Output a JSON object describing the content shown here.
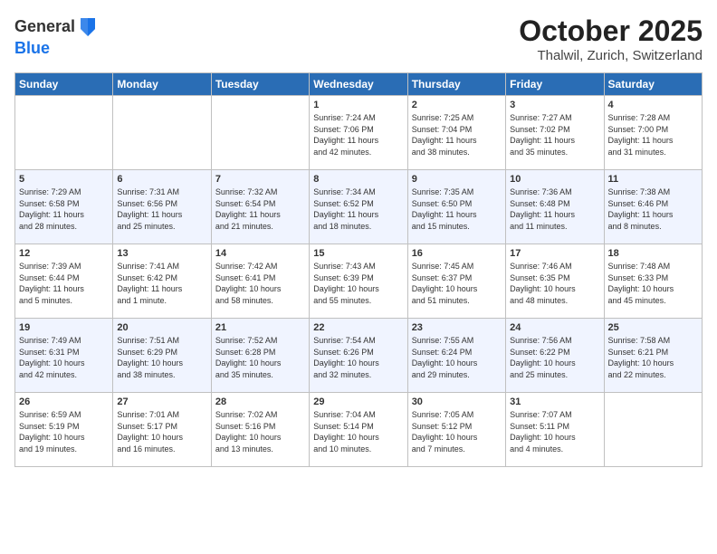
{
  "header": {
    "logo_line1": "General",
    "logo_line2": "Blue",
    "month": "October 2025",
    "location": "Thalwil, Zurich, Switzerland"
  },
  "days_of_week": [
    "Sunday",
    "Monday",
    "Tuesday",
    "Wednesday",
    "Thursday",
    "Friday",
    "Saturday"
  ],
  "weeks": [
    [
      {
        "day": "",
        "info": ""
      },
      {
        "day": "",
        "info": ""
      },
      {
        "day": "",
        "info": ""
      },
      {
        "day": "1",
        "info": "Sunrise: 7:24 AM\nSunset: 7:06 PM\nDaylight: 11 hours\nand 42 minutes."
      },
      {
        "day": "2",
        "info": "Sunrise: 7:25 AM\nSunset: 7:04 PM\nDaylight: 11 hours\nand 38 minutes."
      },
      {
        "day": "3",
        "info": "Sunrise: 7:27 AM\nSunset: 7:02 PM\nDaylight: 11 hours\nand 35 minutes."
      },
      {
        "day": "4",
        "info": "Sunrise: 7:28 AM\nSunset: 7:00 PM\nDaylight: 11 hours\nand 31 minutes."
      }
    ],
    [
      {
        "day": "5",
        "info": "Sunrise: 7:29 AM\nSunset: 6:58 PM\nDaylight: 11 hours\nand 28 minutes."
      },
      {
        "day": "6",
        "info": "Sunrise: 7:31 AM\nSunset: 6:56 PM\nDaylight: 11 hours\nand 25 minutes."
      },
      {
        "day": "7",
        "info": "Sunrise: 7:32 AM\nSunset: 6:54 PM\nDaylight: 11 hours\nand 21 minutes."
      },
      {
        "day": "8",
        "info": "Sunrise: 7:34 AM\nSunset: 6:52 PM\nDaylight: 11 hours\nand 18 minutes."
      },
      {
        "day": "9",
        "info": "Sunrise: 7:35 AM\nSunset: 6:50 PM\nDaylight: 11 hours\nand 15 minutes."
      },
      {
        "day": "10",
        "info": "Sunrise: 7:36 AM\nSunset: 6:48 PM\nDaylight: 11 hours\nand 11 minutes."
      },
      {
        "day": "11",
        "info": "Sunrise: 7:38 AM\nSunset: 6:46 PM\nDaylight: 11 hours\nand 8 minutes."
      }
    ],
    [
      {
        "day": "12",
        "info": "Sunrise: 7:39 AM\nSunset: 6:44 PM\nDaylight: 11 hours\nand 5 minutes."
      },
      {
        "day": "13",
        "info": "Sunrise: 7:41 AM\nSunset: 6:42 PM\nDaylight: 11 hours\nand 1 minute."
      },
      {
        "day": "14",
        "info": "Sunrise: 7:42 AM\nSunset: 6:41 PM\nDaylight: 10 hours\nand 58 minutes."
      },
      {
        "day": "15",
        "info": "Sunrise: 7:43 AM\nSunset: 6:39 PM\nDaylight: 10 hours\nand 55 minutes."
      },
      {
        "day": "16",
        "info": "Sunrise: 7:45 AM\nSunset: 6:37 PM\nDaylight: 10 hours\nand 51 minutes."
      },
      {
        "day": "17",
        "info": "Sunrise: 7:46 AM\nSunset: 6:35 PM\nDaylight: 10 hours\nand 48 minutes."
      },
      {
        "day": "18",
        "info": "Sunrise: 7:48 AM\nSunset: 6:33 PM\nDaylight: 10 hours\nand 45 minutes."
      }
    ],
    [
      {
        "day": "19",
        "info": "Sunrise: 7:49 AM\nSunset: 6:31 PM\nDaylight: 10 hours\nand 42 minutes."
      },
      {
        "day": "20",
        "info": "Sunrise: 7:51 AM\nSunset: 6:29 PM\nDaylight: 10 hours\nand 38 minutes."
      },
      {
        "day": "21",
        "info": "Sunrise: 7:52 AM\nSunset: 6:28 PM\nDaylight: 10 hours\nand 35 minutes."
      },
      {
        "day": "22",
        "info": "Sunrise: 7:54 AM\nSunset: 6:26 PM\nDaylight: 10 hours\nand 32 minutes."
      },
      {
        "day": "23",
        "info": "Sunrise: 7:55 AM\nSunset: 6:24 PM\nDaylight: 10 hours\nand 29 minutes."
      },
      {
        "day": "24",
        "info": "Sunrise: 7:56 AM\nSunset: 6:22 PM\nDaylight: 10 hours\nand 25 minutes."
      },
      {
        "day": "25",
        "info": "Sunrise: 7:58 AM\nSunset: 6:21 PM\nDaylight: 10 hours\nand 22 minutes."
      }
    ],
    [
      {
        "day": "26",
        "info": "Sunrise: 6:59 AM\nSunset: 5:19 PM\nDaylight: 10 hours\nand 19 minutes."
      },
      {
        "day": "27",
        "info": "Sunrise: 7:01 AM\nSunset: 5:17 PM\nDaylight: 10 hours\nand 16 minutes."
      },
      {
        "day": "28",
        "info": "Sunrise: 7:02 AM\nSunset: 5:16 PM\nDaylight: 10 hours\nand 13 minutes."
      },
      {
        "day": "29",
        "info": "Sunrise: 7:04 AM\nSunset: 5:14 PM\nDaylight: 10 hours\nand 10 minutes."
      },
      {
        "day": "30",
        "info": "Sunrise: 7:05 AM\nSunset: 5:12 PM\nDaylight: 10 hours\nand 7 minutes."
      },
      {
        "day": "31",
        "info": "Sunrise: 7:07 AM\nSunset: 5:11 PM\nDaylight: 10 hours\nand 4 minutes."
      },
      {
        "day": "",
        "info": ""
      }
    ]
  ]
}
